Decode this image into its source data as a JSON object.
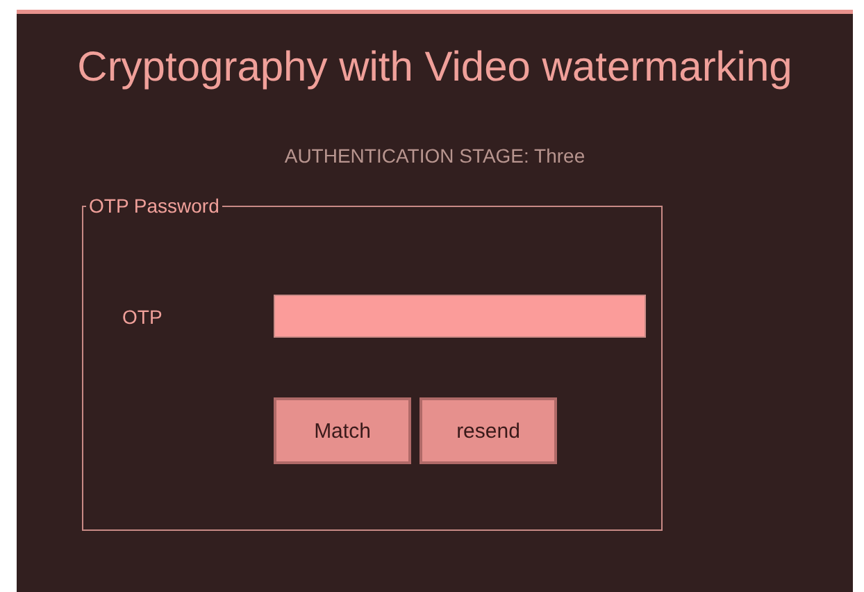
{
  "window": {
    "title": "Cryptography with Video watermarking"
  },
  "stage_label": "AUTHENTICATION STAGE: Three",
  "group": {
    "title": "OTP Password",
    "field": {
      "label": "OTP"
    },
    "buttons": [
      "Match",
      "resend"
    ]
  }
}
